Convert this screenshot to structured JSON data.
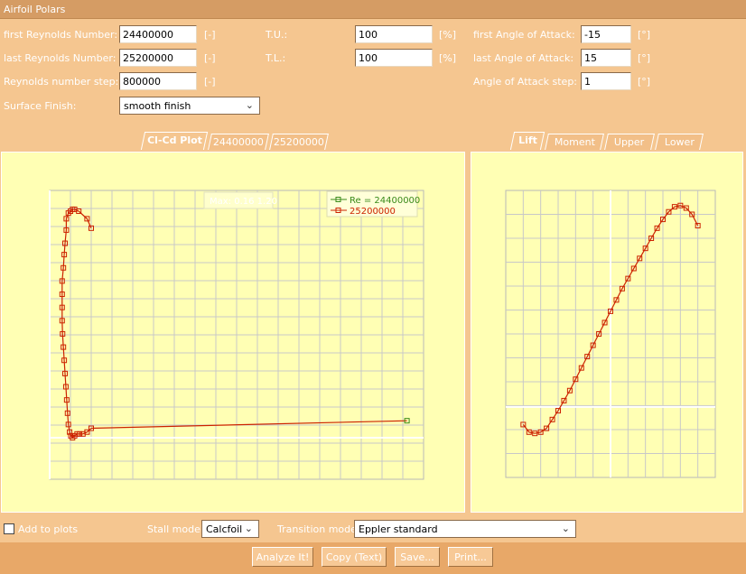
{
  "window": {
    "title": "Airfoil Polars"
  },
  "params": {
    "first_re_label": "first Reynolds Number:",
    "first_re_value": "24400000",
    "first_re_unit": "[-]",
    "last_re_label": "last Reynolds Number:",
    "last_re_value": "25200000",
    "last_re_unit": "[-]",
    "re_step_label": "Reynolds number step:",
    "re_step_value": "800000",
    "re_step_unit": "[-]",
    "surface_label": "Surface Finish:",
    "surface_value": "smooth finish",
    "tu_label": "T.U.:",
    "tu_value": "100",
    "tu_unit": "[%]",
    "tl_label": "T.L.:",
    "tl_value": "100",
    "tl_unit": "[%]",
    "first_aoa_label": "first Angle of Attack:",
    "first_aoa_value": "-15",
    "first_aoa_unit": "[°]",
    "last_aoa_label": "last Angle of Attack:",
    "last_aoa_value": "15",
    "last_aoa_unit": "[°]",
    "aoa_step_label": "Angle of Attack step:",
    "aoa_step_value": "1",
    "aoa_step_unit": "[°]"
  },
  "tabs_left": [
    "Cl-Cd Plot",
    "24400000",
    "25200000"
  ],
  "tabs_right": [
    "Lift",
    "Moment",
    "Upper",
    "Lower"
  ],
  "left_chart": {
    "tooltip": "Max: 0.16 1.20",
    "legend": [
      "Re = 24400000",
      "25200000"
    ]
  },
  "bottom": {
    "add_label": "Add to plots",
    "stall_label": "Stall model:",
    "stall_value": "Calcfoil",
    "transition_label": "Transition model:",
    "transition_value": "Eppler standard"
  },
  "buttons": {
    "analyze": "Analyze It!",
    "copy": "Copy (Text)",
    "save": "Save...",
    "print": "Print..."
  },
  "chart_data": [
    {
      "type": "line",
      "x": [
        0.2,
        0.19,
        0.17,
        0.16,
        0.155,
        0.15,
        0.145,
        0.14,
        0.14,
        0.137,
        0.135,
        0.133,
        0.13,
        0.13,
        0.13,
        0.13,
        0.131,
        0.133,
        0.135,
        0.137,
        0.139,
        0.141,
        0.143,
        0.145,
        0.148,
        0.151,
        0.155,
        0.16,
        0.166,
        0.172,
        0.18,
        0.19,
        0.2
      ],
      "y": [
        1.11,
        1.16,
        1.2,
        1.21,
        1.21,
        1.2,
        1.19,
        1.16,
        1.1,
        1.03,
        0.97,
        0.9,
        0.83,
        0.76,
        0.69,
        0.62,
        0.55,
        0.48,
        0.41,
        0.34,
        0.27,
        0.2,
        0.13,
        0.07,
        0.03,
        0.01,
        0.0,
        0.01,
        0.02,
        0.02,
        0.02,
        0.03,
        0.05
      ],
      "series": [
        {
          "name": "Re = 24400000"
        },
        {
          "name": "25200000"
        }
      ],
      "colors": {
        "series1": "#3a8a1a",
        "series2": "#cc2200"
      }
    },
    {
      "type": "line",
      "x": [
        -15,
        -14,
        -13,
        -12,
        -11,
        -10,
        -9,
        -8,
        -7,
        -6,
        -5,
        -4,
        -3,
        -2,
        -1,
        0,
        1,
        2,
        3,
        4,
        5,
        6,
        7,
        8,
        9,
        10,
        11,
        12,
        13,
        14,
        15
      ],
      "y": [
        -0.14,
        -0.2,
        -0.21,
        -0.2,
        -0.17,
        -0.1,
        -0.03,
        0.05,
        0.13,
        0.22,
        0.31,
        0.4,
        0.49,
        0.58,
        0.67,
        0.76,
        0.85,
        0.94,
        1.02,
        1.1,
        1.18,
        1.26,
        1.34,
        1.42,
        1.49,
        1.55,
        1.59,
        1.6,
        1.58,
        1.53,
        1.44
      ]
    }
  ]
}
